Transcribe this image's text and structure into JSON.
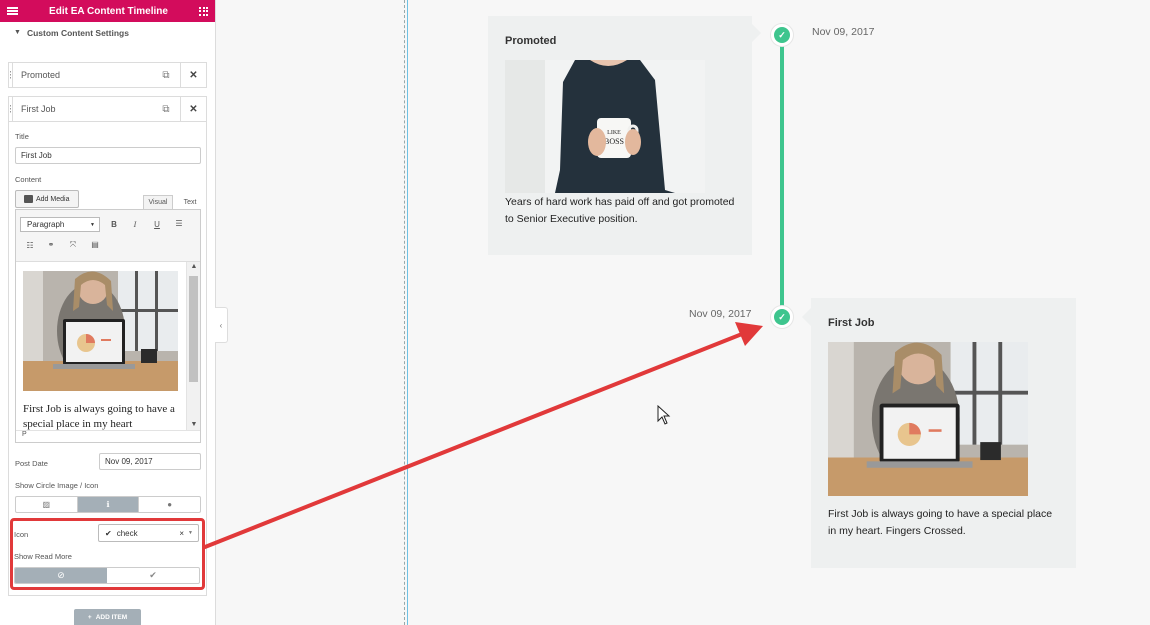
{
  "sidebar": {
    "header_title": "Edit EA Content Timeline",
    "section_label": "Custom Content Settings",
    "items": [
      {
        "label": "Promoted"
      },
      {
        "label": "First Job"
      }
    ],
    "fields": {
      "title_label": "Title",
      "title_value": "First Job",
      "content_label": "Content",
      "add_media_label": "Add Media",
      "tab_visual": "Visual",
      "tab_text": "Text",
      "paragraph_select": "Paragraph",
      "editor_text": "First Job is always going to have a special place in my heart",
      "editor_status": "P",
      "post_date_label": "Post Date",
      "post_date_value": "Nov 09, 2017",
      "show_circle_label": "Show Circle Image / Icon",
      "icon_label": "Icon",
      "icon_value": "check",
      "show_read_more_label": "Show Read More",
      "add_item_label": "ADD ITEM"
    }
  },
  "timeline": {
    "entries": [
      {
        "title": "Promoted",
        "date": "Nov 09, 2017",
        "text": "Years of hard work has paid off and got promoted to Senior Executive position."
      },
      {
        "title": "First Job",
        "date": "Nov 09, 2017",
        "text": "First Job is always going to have a special place in my heart. Fingers Crossed."
      }
    ]
  },
  "colors": {
    "header": "#d30c5c",
    "timeline_green": "#3ec58e",
    "annotation_red": "#e1393a",
    "card_bg": "#eef0f0"
  }
}
